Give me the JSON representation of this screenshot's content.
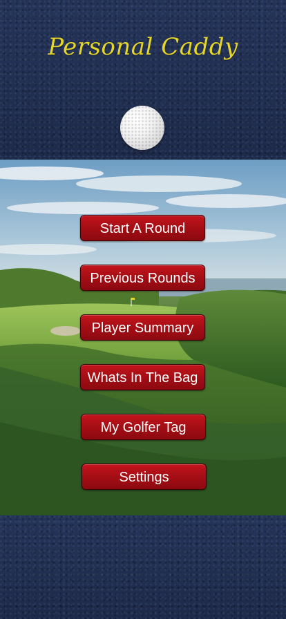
{
  "app": {
    "title": "Personal Caddy"
  },
  "icons": {
    "logo": "golf-ball-icon"
  },
  "colors": {
    "title": "#e6d62a",
    "background": "#213155",
    "button": "#a40e14",
    "button_text": "#ffffff"
  },
  "menu": {
    "items": [
      {
        "label": "Start A Round"
      },
      {
        "label": "Previous Rounds"
      },
      {
        "label": "Player Summary"
      },
      {
        "label": "Whats In The Bag"
      },
      {
        "label": "My Golfer Tag"
      },
      {
        "label": "Settings"
      }
    ]
  }
}
